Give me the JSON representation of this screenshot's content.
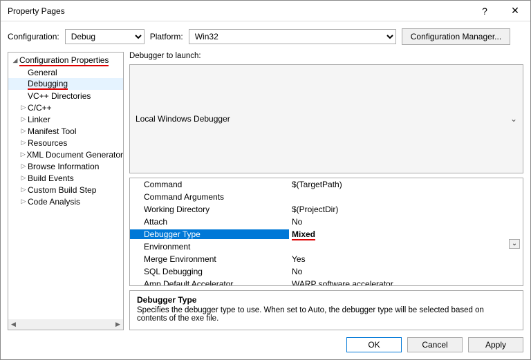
{
  "window": {
    "title": "Property Pages"
  },
  "config": {
    "labelConfig": "Configuration:",
    "valueConfig": "Debug",
    "labelPlatform": "Platform:",
    "valuePlatform": "Win32",
    "btnConfigMgr": "Configuration Manager..."
  },
  "tree": {
    "items": [
      {
        "label": "Configuration Properties",
        "level": 0,
        "expanded": true,
        "underline": true
      },
      {
        "label": "General",
        "level": 1,
        "leaf": true
      },
      {
        "label": "Debugging",
        "level": 1,
        "leaf": true,
        "selected": true,
        "underline": true
      },
      {
        "label": "VC++ Directories",
        "level": 1,
        "leaf": true
      },
      {
        "label": "C/C++",
        "level": 1
      },
      {
        "label": "Linker",
        "level": 1
      },
      {
        "label": "Manifest Tool",
        "level": 1
      },
      {
        "label": "Resources",
        "level": 1
      },
      {
        "label": "XML Document Generator",
        "level": 1
      },
      {
        "label": "Browse Information",
        "level": 1
      },
      {
        "label": "Build Events",
        "level": 1
      },
      {
        "label": "Custom Build Step",
        "level": 1
      },
      {
        "label": "Code Analysis",
        "level": 1
      }
    ]
  },
  "launch": {
    "label": "Debugger to launch:",
    "value": "Local Windows Debugger"
  },
  "grid": {
    "rows": [
      {
        "name": "Command",
        "value": "$(TargetPath)"
      },
      {
        "name": "Command Arguments",
        "value": ""
      },
      {
        "name": "Working Directory",
        "value": "$(ProjectDir)"
      },
      {
        "name": "Attach",
        "value": "No"
      },
      {
        "name": "Debugger Type",
        "value": "Mixed",
        "selected": true,
        "dropdown": true,
        "underline": true
      },
      {
        "name": "Environment",
        "value": ""
      },
      {
        "name": "Merge Environment",
        "value": "Yes"
      },
      {
        "name": "SQL Debugging",
        "value": "No"
      },
      {
        "name": "Amp Default Accelerator",
        "value": "WARP software accelerator"
      }
    ]
  },
  "help": {
    "title": "Debugger Type",
    "text": "Specifies the debugger type to use. When set to Auto, the debugger type will be selected based on contents of the exe file."
  },
  "buttons": {
    "ok": "OK",
    "cancel": "Cancel",
    "apply": "Apply"
  }
}
